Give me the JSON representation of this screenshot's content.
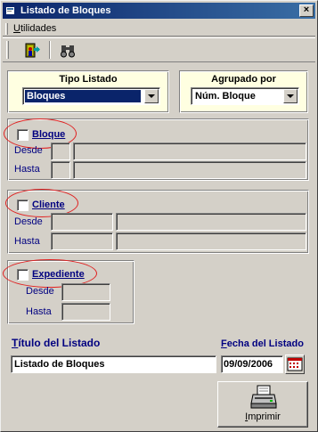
{
  "window": {
    "title": "Listado de Bloques",
    "close_label": "×"
  },
  "menu": {
    "items": [
      {
        "label": "Utilidades",
        "accel": "U",
        "rest": "tilidades"
      }
    ]
  },
  "toolbar": {
    "buttons": [
      {
        "name": "exit-icon"
      },
      {
        "name": "binoculars-icon"
      }
    ]
  },
  "tipo_listado": {
    "label": "Tipo Listado",
    "value": "Bloques"
  },
  "agrupado_por": {
    "label": "Agrupado por",
    "value": "Núm. Bloque"
  },
  "filters": {
    "bloque": {
      "label": "Bloque",
      "checked": false,
      "desde": "Desde",
      "hasta": "Hasta"
    },
    "cliente": {
      "label": "Cliente",
      "checked": false,
      "desde": "Desde",
      "hasta": "Hasta"
    },
    "expediente": {
      "label": "Expediente",
      "checked": false,
      "desde": "Desde",
      "hasta": "Hasta"
    }
  },
  "titulo_listado": {
    "label_accel": "T",
    "label_rest": "ítulo del Listado",
    "value": "Listado de Bloques"
  },
  "fecha_listado": {
    "label_accel": "F",
    "label_rest": "echa del Listado",
    "value": "09/09/2006"
  },
  "print_button": {
    "label_accel": "I",
    "label_rest": "mprimir"
  },
  "colors": {
    "titlebar_start": "#0a246a",
    "titlebar_end": "#3a6ea5",
    "panel_cream": "#ffffe1",
    "label_navy": "#000080",
    "annotation_red": "#e02020",
    "face": "#d4d0c8"
  }
}
